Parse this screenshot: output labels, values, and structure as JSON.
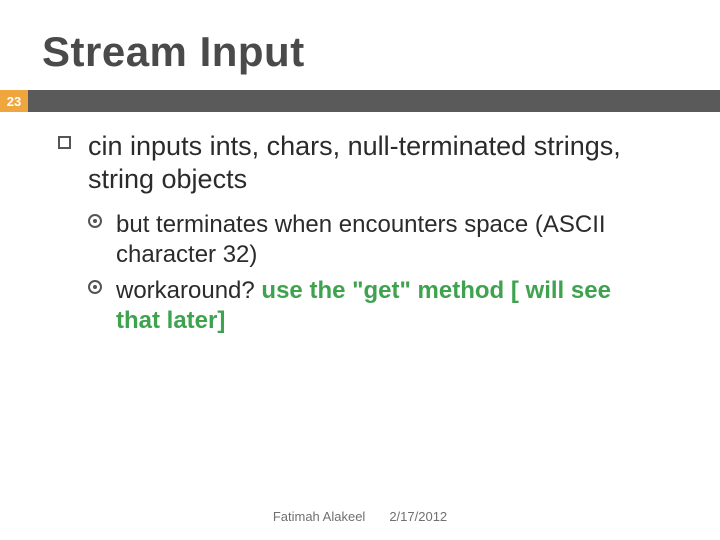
{
  "title": "Stream Input",
  "slide_number": "23",
  "bullets": {
    "lvl1_text": "cin inputs ints, chars, null-terminated strings, string objects",
    "lvl2a_text": "but terminates when encounters space (ASCII character 32)",
    "lvl2b_prefix": "workaround? ",
    "lvl2b_bold": "use the \"get\" method [ will see that later]"
  },
  "footer": {
    "author": "Fatimah Alakeel",
    "date": "2/17/2012"
  }
}
